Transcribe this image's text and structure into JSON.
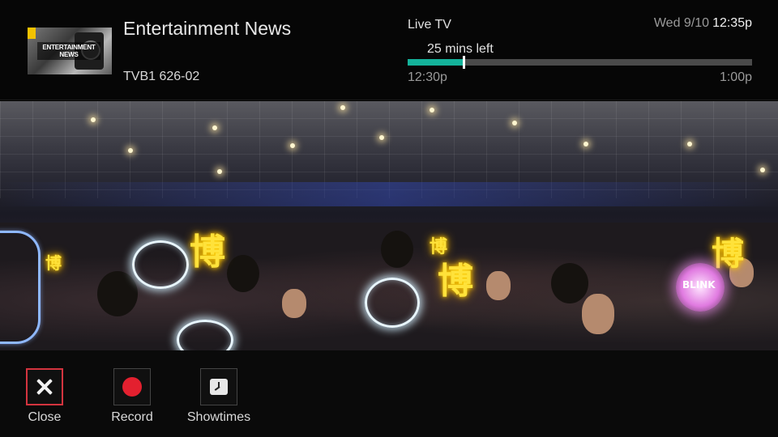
{
  "header": {
    "show_title": "Entertainment News",
    "channel": "TVB1 626-02",
    "thumbnail_text": "ENTERTAINMENT NEWS",
    "source_label": "Live TV",
    "time_left": "25 mins left",
    "start_time": "12:30p",
    "end_time": "1:00p",
    "date": "Wed 9/10",
    "clock": "12:35p",
    "progress_fraction": 0.162,
    "progress_color": "#14b39b"
  },
  "video": {
    "sign_glyph": "博",
    "pink_sign_text": "BLINK"
  },
  "controls": {
    "close_label": "Close",
    "record_label": "Record",
    "showtimes_label": "Showtimes",
    "close_icon": "close-icon",
    "record_icon": "record-dot-icon",
    "showtimes_icon": "clock-icon",
    "selected": "close",
    "record_color": "#e3202f",
    "focus_color": "#d4343f"
  }
}
